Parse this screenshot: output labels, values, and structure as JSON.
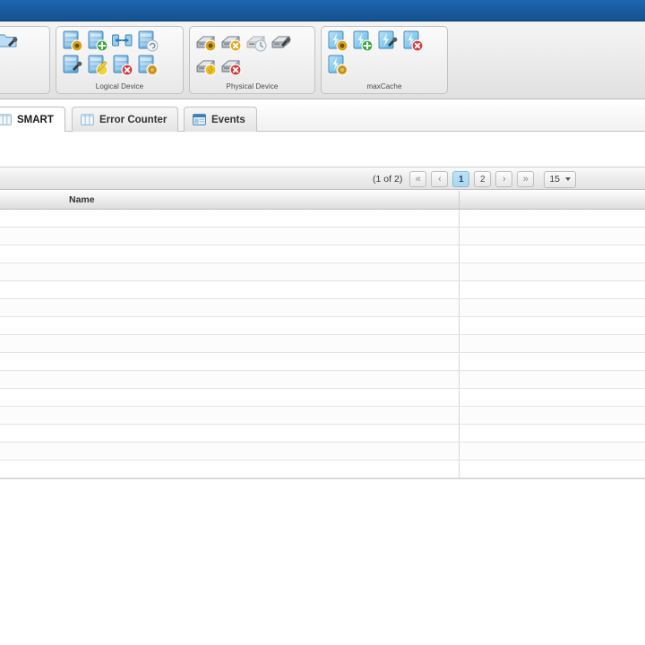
{
  "titlebar": {
    "color": "#18599e"
  },
  "ribbon": {
    "groups": [
      {
        "id": "controller",
        "label": "",
        "icons": [
          {
            "name": "controller-settings-icon",
            "kind": "disk",
            "badge": "gear"
          },
          {
            "name": "controller-wizard-icon",
            "kind": "folder",
            "badge": "wrench"
          }
        ]
      },
      {
        "id": "logical",
        "label": "Logical Device",
        "icons": [
          {
            "name": "logical-device-properties-icon",
            "kind": "disk",
            "badge": "gear"
          },
          {
            "name": "logical-device-create-icon",
            "kind": "disk",
            "badge": "plus"
          },
          {
            "name": "logical-device-expand-icon",
            "kind": "disk-wide",
            "badge": "arrows"
          },
          {
            "name": "logical-device-refresh-icon",
            "kind": "disk",
            "badge": "refresh"
          },
          {
            "name": "logical-device-verify-icon",
            "kind": "disk",
            "badge": "wrench"
          },
          {
            "name": "logical-device-modify-icon",
            "kind": "disk",
            "badge": "pencil"
          },
          {
            "name": "logical-device-delete-icon",
            "kind": "disk",
            "badge": "cross"
          },
          {
            "name": "logical-device-cache-icon",
            "kind": "disk",
            "badge": "coin"
          }
        ]
      },
      {
        "id": "physical",
        "label": "Physical Device",
        "icons": [
          {
            "name": "physical-device-settings-icon",
            "kind": "drive",
            "badge": "gear"
          },
          {
            "name": "physical-device-remove-icon",
            "kind": "drive",
            "badge": "xmark"
          },
          {
            "name": "physical-device-clock-icon",
            "kind": "drive-dim",
            "badge": "clock"
          },
          {
            "name": "physical-device-tool-icon",
            "kind": "drive",
            "badge": "wrench"
          },
          {
            "name": "physical-device-initialize-icon",
            "kind": "drive",
            "badge": "bolt"
          },
          {
            "name": "physical-device-delete-icon",
            "kind": "drive",
            "badge": "cross"
          }
        ]
      },
      {
        "id": "maxcache",
        "label": "maxCache",
        "icons": [
          {
            "name": "maxcache-properties-icon",
            "kind": "flash",
            "badge": "gear"
          },
          {
            "name": "maxcache-create-icon",
            "kind": "flash",
            "badge": "plus"
          },
          {
            "name": "maxcache-tool-icon",
            "kind": "flash",
            "badge": "wrench"
          },
          {
            "name": "maxcache-delete-icon",
            "kind": "flash",
            "badge": "cross"
          },
          {
            "name": "maxcache-pool-icon",
            "kind": "flash",
            "badge": "coin"
          }
        ]
      }
    ]
  },
  "tabs": [
    {
      "id": "smart",
      "label": "SMART",
      "icon": "grid-icon",
      "active": true
    },
    {
      "id": "error",
      "label": "Error Counter",
      "icon": "grid-icon",
      "active": false
    },
    {
      "id": "events",
      "label": "Events",
      "icon": "window-icon",
      "active": false
    }
  ],
  "pager": {
    "count_label": "(1 of 2)",
    "first_label": "«",
    "prev_label": "‹",
    "pages": [
      {
        "label": "1",
        "current": true
      },
      {
        "label": "2",
        "current": false
      }
    ],
    "next_label": "›",
    "last_label": "»",
    "page_size": "15"
  },
  "grid": {
    "columns": [
      {
        "key": "name",
        "label": "Name"
      },
      {
        "key": "value",
        "label": ""
      }
    ],
    "rows": [
      {
        "name": "",
        "value": ""
      },
      {
        "name": "",
        "value": ""
      },
      {
        "name": "",
        "value": ""
      },
      {
        "name": "",
        "value": ""
      },
      {
        "name": "",
        "value": ""
      },
      {
        "name": "",
        "value": ""
      },
      {
        "name": "",
        "value": ""
      },
      {
        "name": "",
        "value": ""
      },
      {
        "name": "",
        "value": ""
      },
      {
        "name": "",
        "value": ""
      },
      {
        "name": "",
        "value": ""
      },
      {
        "name": "",
        "value": ""
      },
      {
        "name": "",
        "value": ""
      },
      {
        "name": "",
        "value": ""
      },
      {
        "name": "",
        "value": ""
      }
    ]
  }
}
